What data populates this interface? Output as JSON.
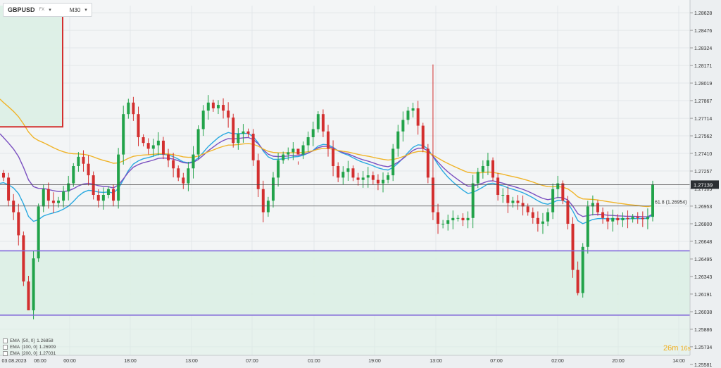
{
  "symbol": {
    "name": "GBPUSD",
    "market": "FX",
    "timeframe": "M30"
  },
  "countdown": {
    "minutes": "26m",
    "seconds": "16s"
  },
  "legend": [
    {
      "label": "EMA",
      "params": "[50, 0]",
      "value": "1.26858",
      "color": "#29a9e0"
    },
    {
      "label": "EMA",
      "params": "[100, 0]",
      "value": "1.26909",
      "color": "#7a4fc0"
    },
    {
      "label": "EMA",
      "params": "[200, 0]",
      "value": "1.27031",
      "color": "#f0b429"
    }
  ],
  "chart_data": {
    "type": "candlestick",
    "ylim": [
      1.2566,
      1.2869
    ],
    "price_ticks": [
      "1.28628",
      "1.28476",
      "1.28324",
      "1.28171",
      "1.28019",
      "1.27867",
      "1.27714",
      "1.27562",
      "1.27410",
      "1.27257",
      "1.27105",
      "1.26953",
      "1.26800",
      "1.26648",
      "1.26495",
      "1.26343",
      "1.26191",
      "1.26038",
      "1.25886",
      "1.25734",
      "1.25581"
    ],
    "time_labels": [
      "03.08.2023",
      "06:00",
      "00:00",
      "18:00",
      "13:00",
      "07:00",
      "01:00",
      "19:00",
      "13:00",
      "07:00",
      "02:00",
      "20:00",
      "14:00"
    ],
    "last_price": {
      "label": "1.27139",
      "value": 1.27139
    },
    "fib_level": {
      "label": "61.8 (1.26954)",
      "value": 1.26954
    },
    "h_lines": [
      1.26565,
      1.26008
    ],
    "red_level": 1.2764,
    "zone_colors": {
      "up": "#22a34a",
      "down": "#d32f2f",
      "zone": "#dcefe6"
    },
    "closes": [
      1.272,
      1.27,
      1.269,
      1.267,
      1.263,
      1.2605,
      1.265,
      1.2695,
      1.271,
      1.27,
      1.2698,
      1.27,
      1.2708,
      1.2715,
      1.273,
      1.2738,
      1.2732,
      1.2722,
      1.2705,
      1.27,
      1.2705,
      1.271,
      1.27,
      1.274,
      1.2775,
      1.2785,
      1.2775,
      1.2755,
      1.275,
      1.2745,
      1.2748,
      1.2752,
      1.274,
      1.2735,
      1.2728,
      1.272,
      1.2715,
      1.2728,
      1.274,
      1.2762,
      1.2778,
      1.2785,
      1.278,
      1.2783,
      1.2778,
      1.2772,
      1.275,
      1.2758,
      1.276,
      1.2758,
      1.2735,
      1.271,
      1.269,
      1.27,
      1.272,
      1.2735,
      1.274,
      1.2742,
      1.2745,
      1.274,
      1.2748,
      1.2755,
      1.2762,
      1.2775,
      1.276,
      1.2745,
      1.273,
      1.272,
      1.2725,
      1.2728,
      1.272,
      1.2718,
      1.272,
      1.2722,
      1.2718,
      1.2715,
      1.2718,
      1.2722,
      1.2745,
      1.276,
      1.277,
      1.2778,
      1.278,
      1.2765,
      1.2745,
      1.272,
      1.269,
      1.268,
      1.268,
      1.2683,
      1.2685,
      1.2685,
      1.2683,
      1.2685,
      1.2715,
      1.2725,
      1.273,
      1.2735,
      1.272,
      1.2705,
      1.2705,
      1.2698,
      1.27,
      1.2698,
      1.2695,
      1.269,
      1.2685,
      1.268,
      1.2682,
      1.269,
      1.271,
      1.2715,
      1.27,
      1.268,
      1.264,
      1.262,
      1.266,
      1.2695,
      1.2698,
      1.269,
      1.2685,
      1.2682,
      1.2685,
      1.2683,
      1.2685,
      1.2684,
      1.2686,
      1.2685,
      1.2684,
      1.2686,
      1.2714
    ]
  }
}
